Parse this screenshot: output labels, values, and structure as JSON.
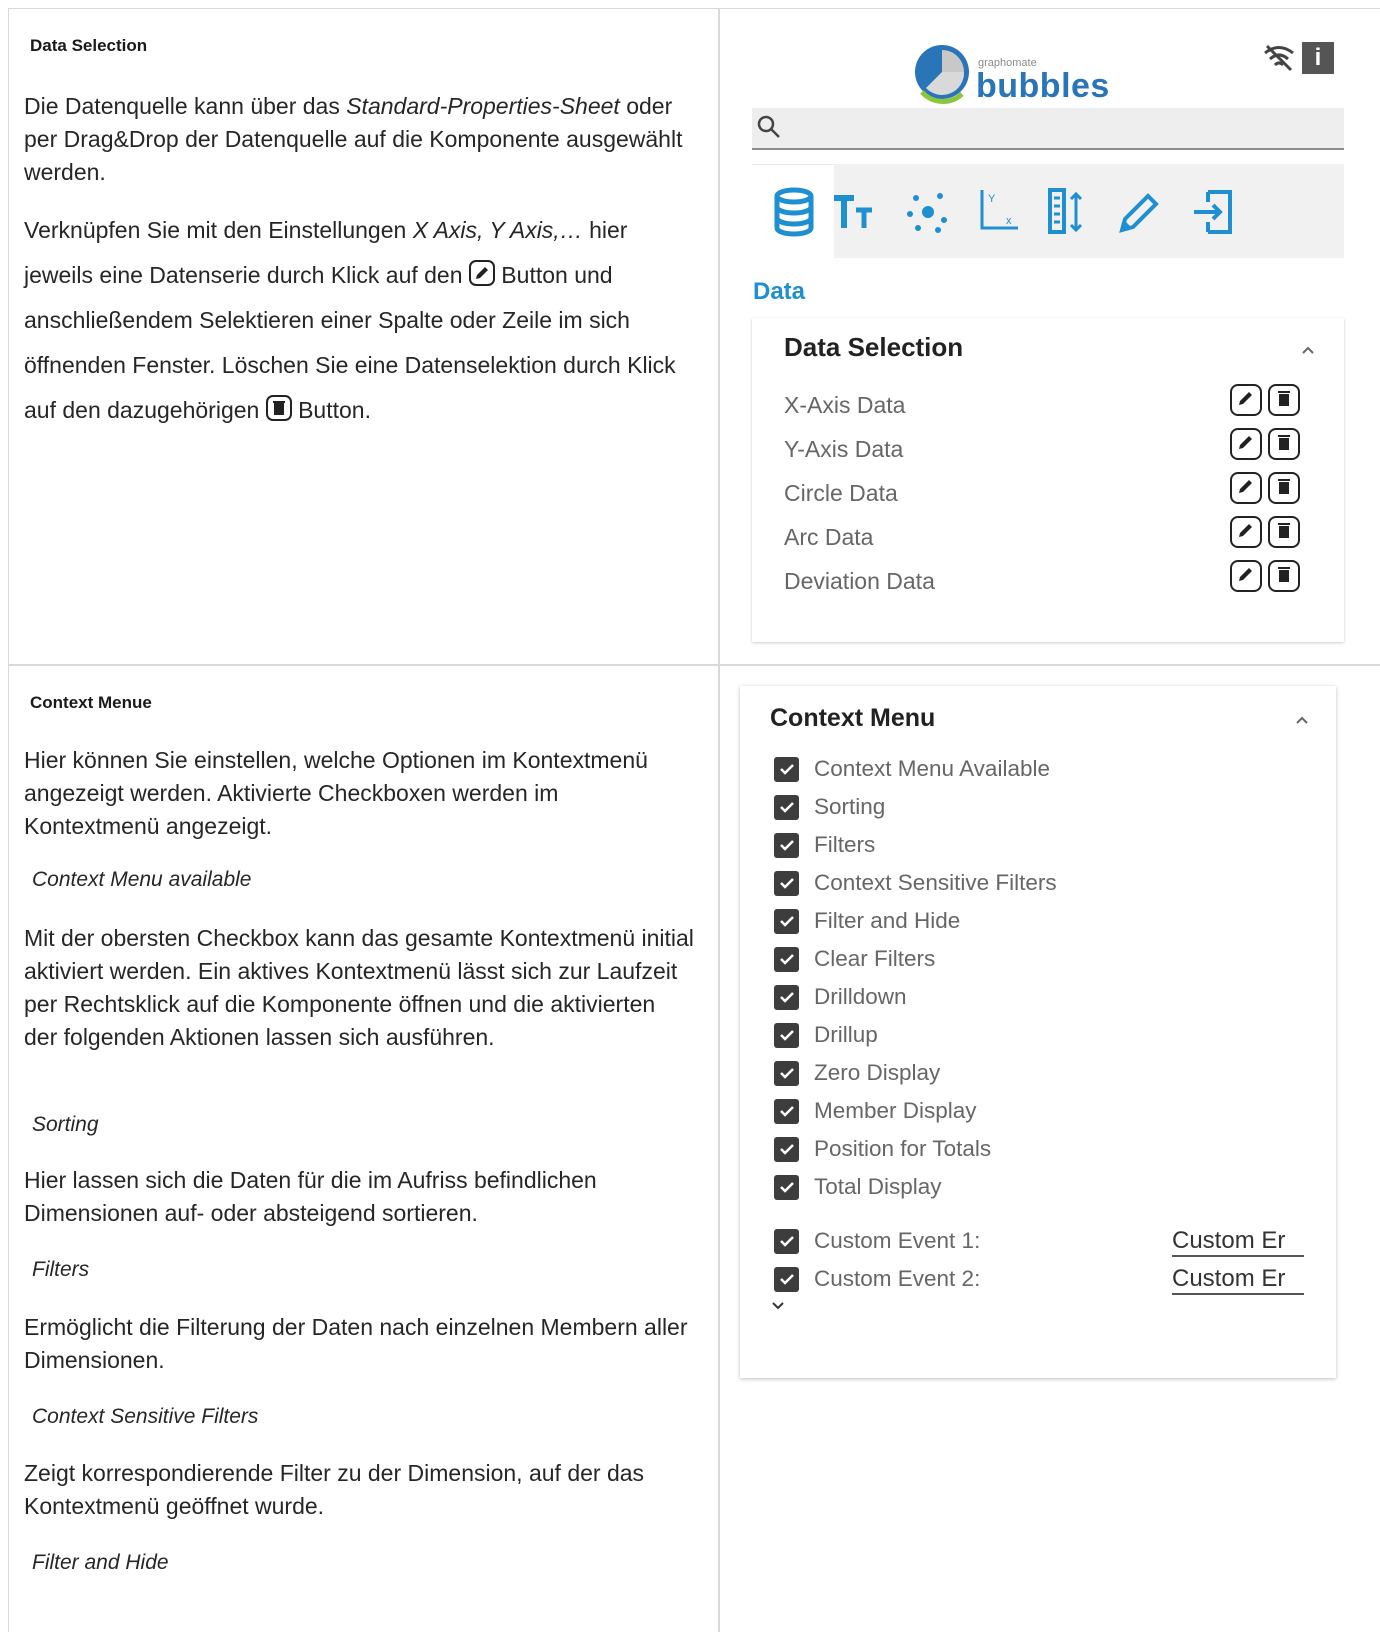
{
  "left": {
    "data_selection": {
      "title": "Data Selection",
      "p1_a": "Die Datenquelle kann über das ",
      "p1_em": "Standard-Properties-Sheet",
      "p1_b": " oder per Drag&Drop der Datenquelle auf die Komponente ausgewählt werden.",
      "p2_a": "Verknüpfen Sie mit den Einstellungen ",
      "p2_em": "X Axis, Y Axis,…",
      "p2_b": " hier jeweils eine Datenserie durch Klick auf den",
      "p2_c": " Button und anschließendem Selektieren einer Spalte oder Zeile im sich öffnenden Fenster. Löschen Sie eine Datenselektion durch Klick auf den dazugehörigen",
      "p2_d": " Button."
    },
    "context_menue": {
      "title": "Context Menue",
      "intro": "Hier können Sie einstellen, welche Optionen im Kontextmenü angezeigt werden. Aktivierte Checkboxen werden im Kontextmenü angezeigt.",
      "sub1": "Context Menu available",
      "text1": "Mit der obersten Checkbox kann das gesamte Kontextmenü initial aktiviert werden. Ein aktives Kontextmenü lässt sich zur Laufzeit per Rechtsklick auf die Komponente öffnen und die aktivierten der folgenden Aktionen lassen sich ausführen.",
      "sub2": "Sorting",
      "text2": "Hier lassen sich die Daten für die im Aufriss befindlichen Dimensionen auf- oder absteigend sortieren.",
      "sub3": "Filters",
      "text3": "Ermöglicht die Filterung der Daten nach einzelnen Membern aller Dimensionen.",
      "sub4": "Context Sensitive Filters",
      "text4": "Zeigt korrespondierende Filter zu der Dimension, auf der das Kontextmenü geöffnet wurde.",
      "sub5": "Filter and Hide"
    }
  },
  "right": {
    "logo_small": "graphomate",
    "logo_big": "bubbles",
    "section_header": "Data",
    "data_selection_card": {
      "title": "Data Selection",
      "rows": [
        "X-Axis Data",
        "Y-Axis Data",
        "Circle Data",
        "Arc Data",
        "Deviation Data"
      ]
    },
    "context_menu_card": {
      "title": "Context Menu",
      "items": [
        "Context Menu Available",
        "Sorting",
        "Filters",
        "Context Sensitive Filters",
        "Filter and Hide",
        "Clear Filters",
        "Drilldown",
        "Drillup",
        "Zero Display",
        "Member Display",
        "Position for Totals",
        "Total Display"
      ],
      "custom_events": [
        {
          "label": "Custom Event 1:",
          "value": "Custom Er"
        },
        {
          "label": "Custom Event 2:",
          "value": "Custom Er"
        }
      ]
    }
  },
  "colors": {
    "accent": "#1e8fd1",
    "logo_blue": "#2a74b8",
    "logo_green": "#8cc63f"
  }
}
